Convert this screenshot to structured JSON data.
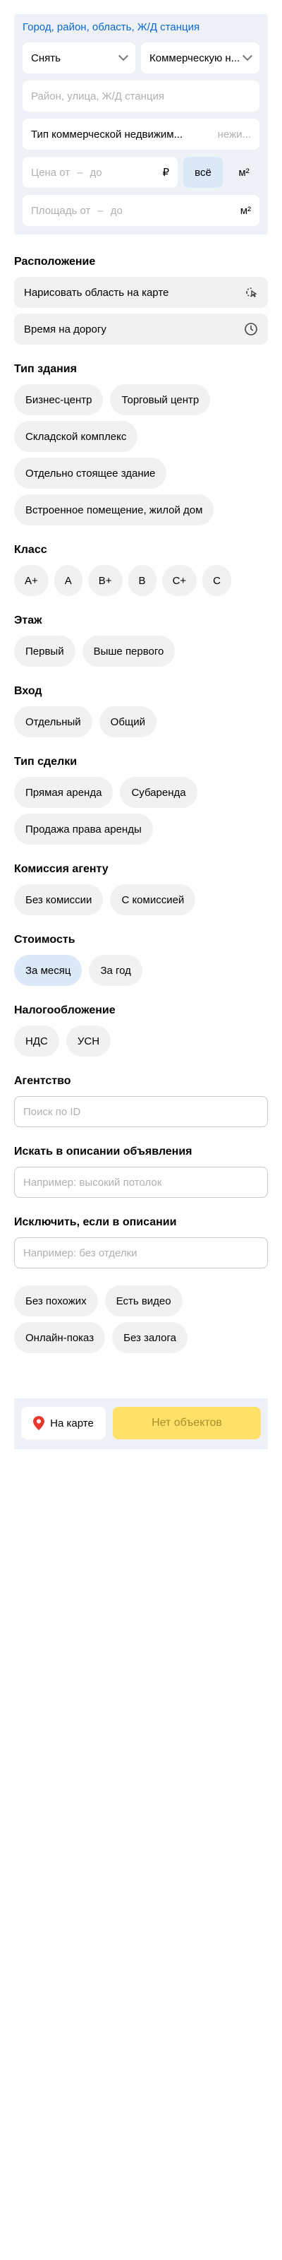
{
  "geo": {
    "link": "Город, район, область, Ж/Д станция"
  },
  "deal_select": "Снять",
  "category_select": "Коммерческую н...",
  "address": {
    "placeholder": "Район, улица, Ж/Д станция"
  },
  "property_type": {
    "label": "Тип коммерческой недвижим...",
    "value": "нежи..."
  },
  "price": {
    "from_placeholder": "Цена от",
    "to_placeholder": "до",
    "currency": "₽",
    "all_label": "всё",
    "per_m2_label": "м²"
  },
  "area": {
    "from_placeholder": "Площадь от",
    "to_placeholder": "до",
    "unit": "м²"
  },
  "location": {
    "title": "Расположение",
    "draw_area": "Нарисовать область на карте",
    "travel_time": "Время на дорогу"
  },
  "building_type": {
    "title": "Тип здания",
    "options": [
      "Бизнес-центр",
      "Торговый центр",
      "Складской комплекс",
      "Отдельно стоящее здание",
      "Встроенное помещение, жилой дом"
    ]
  },
  "class": {
    "title": "Класс",
    "options": [
      "A+",
      "A",
      "B+",
      "B",
      "C+",
      "C"
    ]
  },
  "floor": {
    "title": "Этаж",
    "options": [
      "Первый",
      "Выше первого"
    ]
  },
  "entrance": {
    "title": "Вход",
    "options": [
      "Отдельный",
      "Общий"
    ]
  },
  "deal_type": {
    "title": "Тип сделки",
    "options": [
      "Прямая аренда",
      "Субаренда",
      "Продажа права аренды"
    ]
  },
  "commission": {
    "title": "Комиссия агенту",
    "options": [
      "Без комиссии",
      "С комиссией"
    ]
  },
  "cost": {
    "title": "Стоимость",
    "options": [
      "За месяц",
      "За год"
    ],
    "selected_index": 0
  },
  "taxation": {
    "title": "Налогообложение",
    "options": [
      "НДС",
      "УСН"
    ]
  },
  "agency": {
    "title": "Агентство",
    "placeholder": "Поиск по ID"
  },
  "description_search": {
    "title": "Искать в описании объявления",
    "placeholder": "Например: высокий потолок"
  },
  "description_exclude": {
    "title": "Исключить, если в описании",
    "placeholder": "Например: без отделки"
  },
  "extras": {
    "options": [
      "Без похожих",
      "Есть видео",
      "Онлайн-показ",
      "Без залога"
    ]
  },
  "footer": {
    "map_label": "На карте",
    "submit_label": "Нет объектов"
  },
  "colors": {
    "accent": "#0a67d6",
    "submit": "#ffe169",
    "active_chip": "#dbe8f8",
    "pin": "#e8372c"
  }
}
